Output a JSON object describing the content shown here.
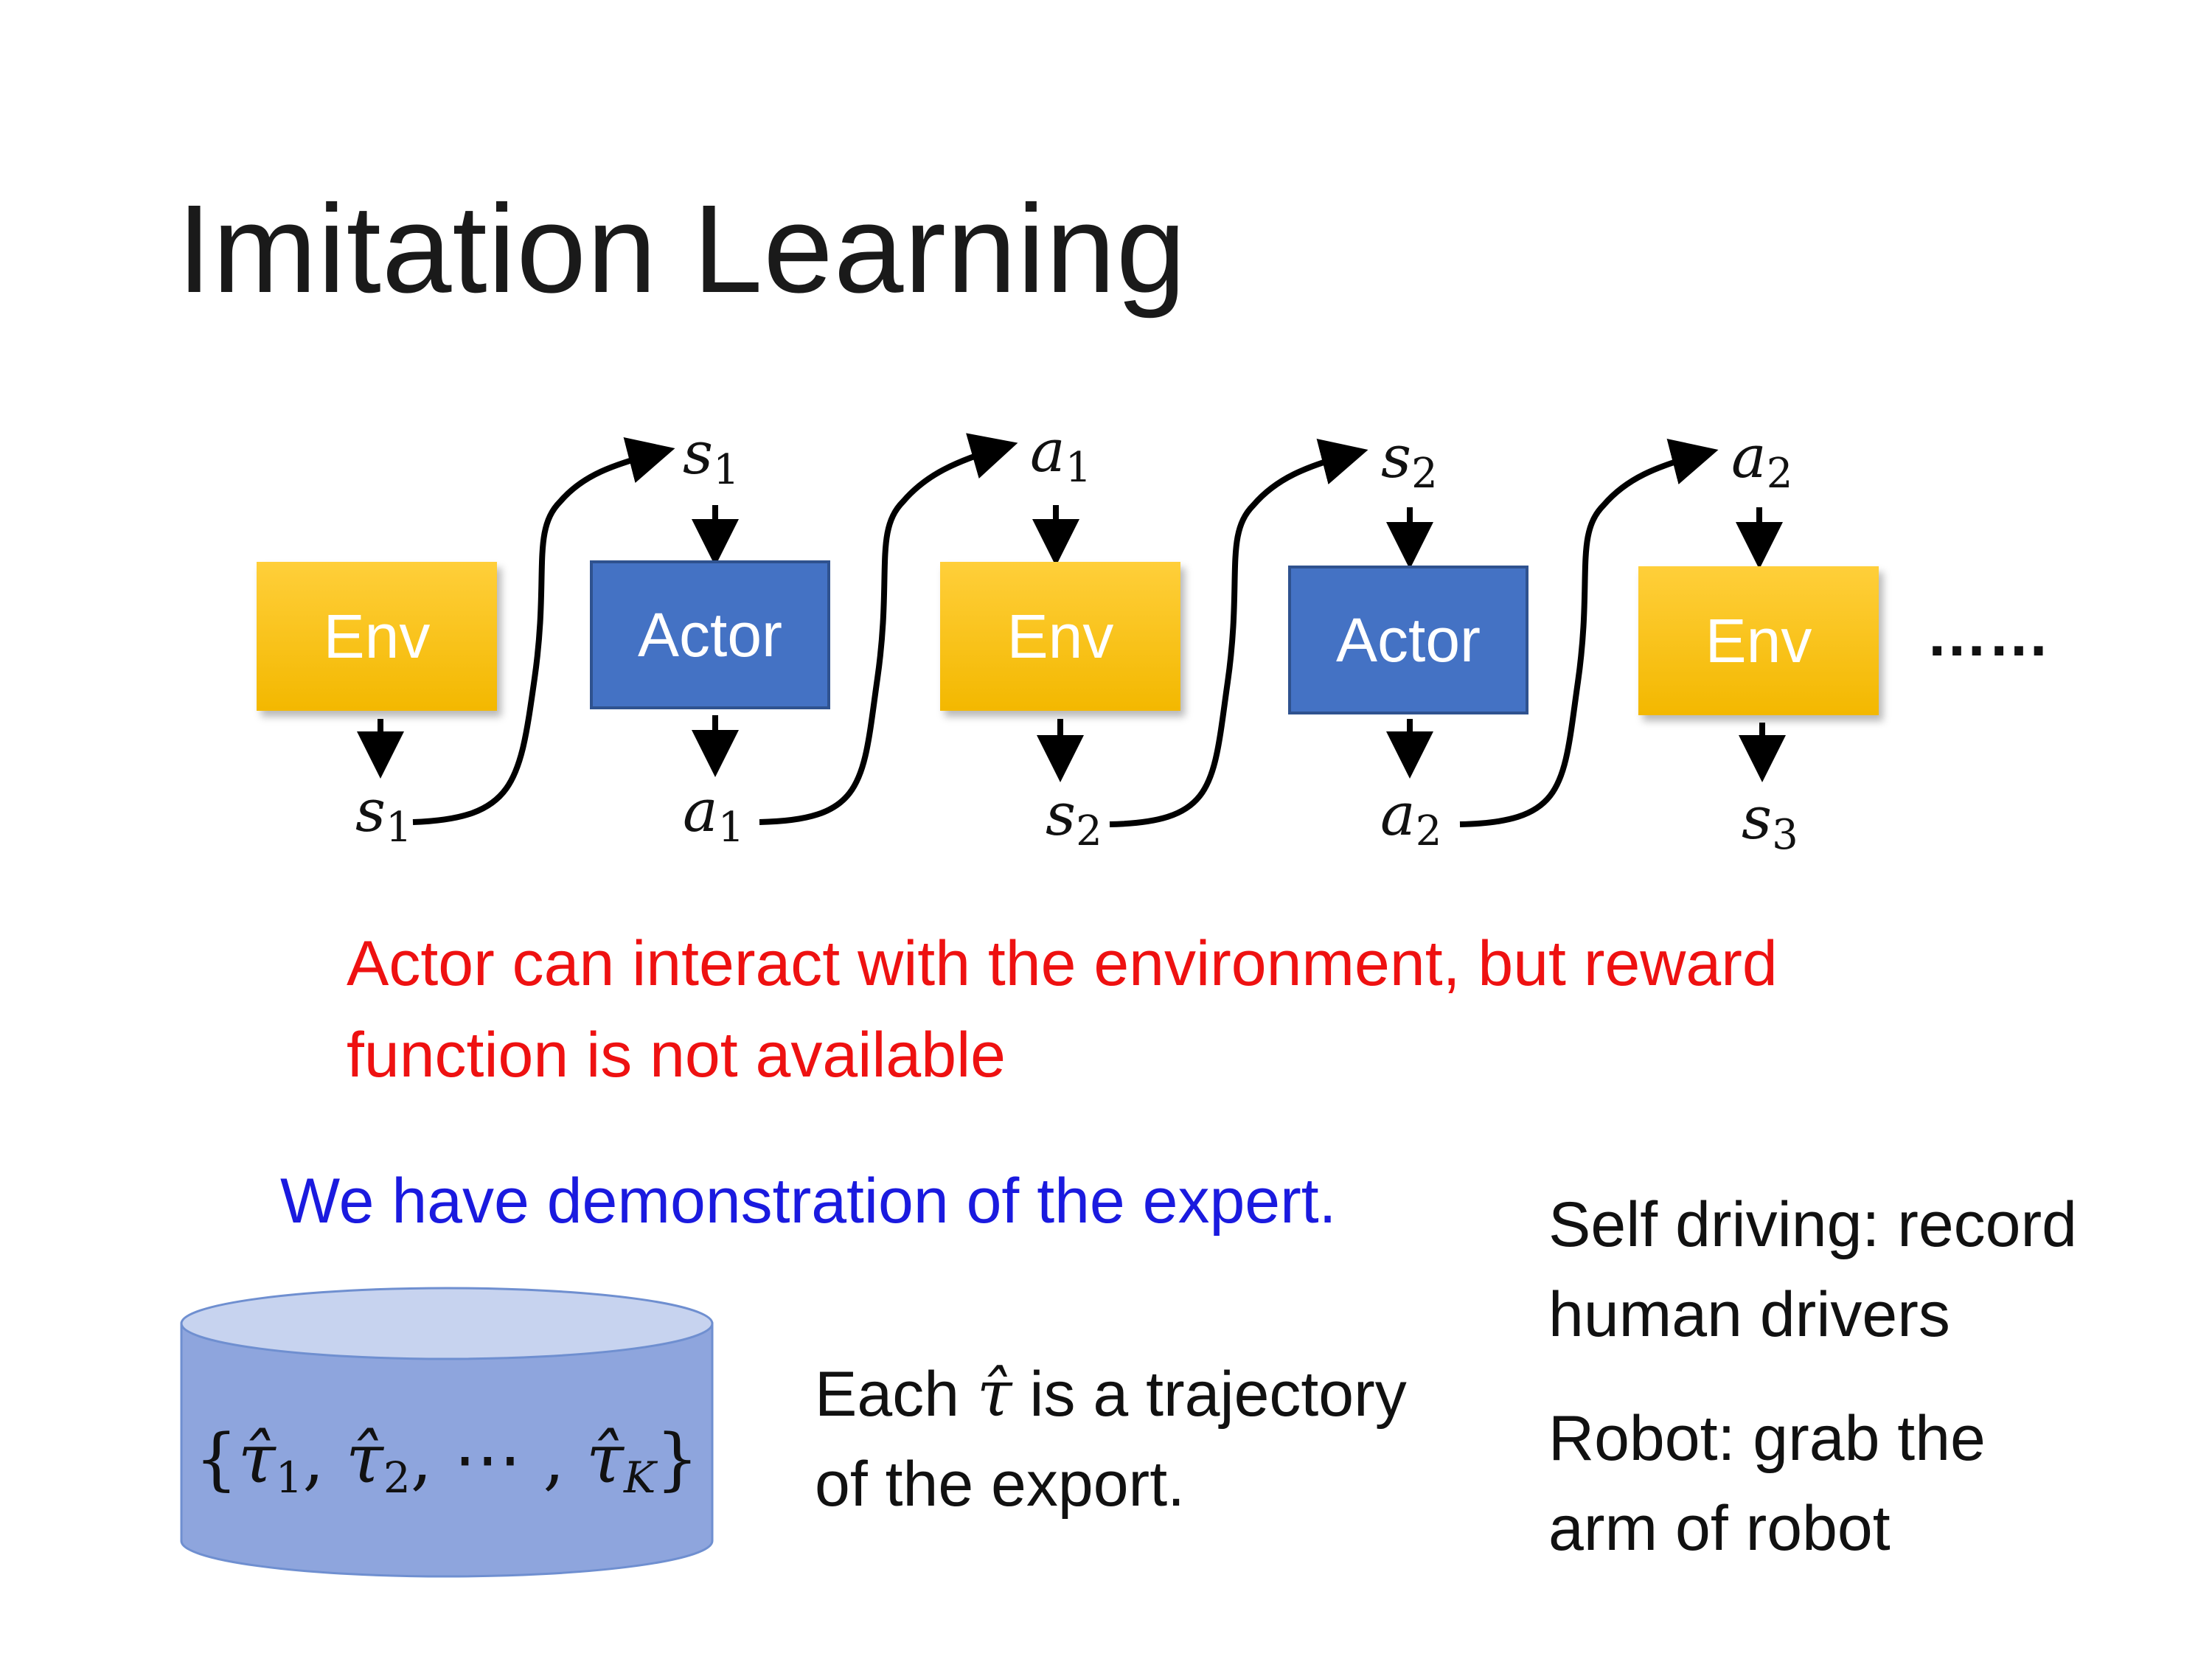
{
  "title": "Imitation Learning",
  "flow": {
    "boxes": [
      "Env",
      "Actor",
      "Env",
      "Actor",
      "Env"
    ],
    "inputs": [
      {
        "sym": "s",
        "sub": "1"
      },
      {
        "sym": "a",
        "sub": "1"
      },
      {
        "sym": "s",
        "sub": "2"
      },
      {
        "sym": "a",
        "sub": "2"
      }
    ],
    "outputs": [
      {
        "sym": "s",
        "sub": "1"
      },
      {
        "sym": "a",
        "sub": "1"
      },
      {
        "sym": "s",
        "sub": "2"
      },
      {
        "sym": "a",
        "sub": "2"
      },
      {
        "sym": "s",
        "sub": "3"
      }
    ],
    "ellipsis": "……"
  },
  "note_red": "Actor can interact with the environment, but reward function is not available",
  "note_blue": "We have demonstration of the expert.",
  "cylinder": {
    "open": "{",
    "t1": "τ̂",
    "t1_sub": "1",
    "sep1": ", ",
    "t2": "τ̂",
    "t2_sub": "2",
    "sep2": ", ⋯ , ",
    "tk": "τ̂",
    "tk_sub": "K",
    "close": "}"
  },
  "each_text": {
    "line1_pre": "Each ",
    "tau": "τ̂",
    "line1_post": " is a trajectory",
    "line2": "of the export."
  },
  "examples": {
    "self_driving_1": "Self driving: record",
    "self_driving_2": "human drivers",
    "robot_1": "Robot: grab the",
    "robot_2": "arm of robot"
  },
  "colors": {
    "env": "#ffc000",
    "actor": "#4472c4",
    "cylinder": "#8ea5dd",
    "red_text": "#ee1111",
    "blue_text": "#1a1adf"
  }
}
